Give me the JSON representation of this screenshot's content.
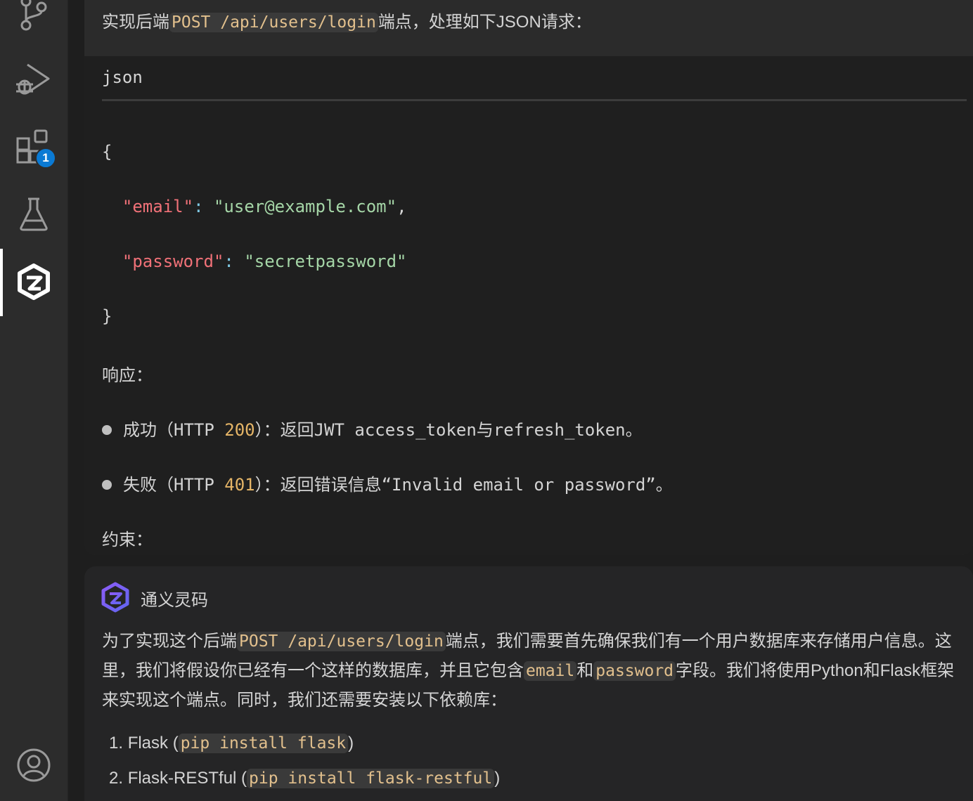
{
  "activity_bar": {
    "items": [
      {
        "name": "source-control",
        "icon": "source-control-icon"
      },
      {
        "name": "run-debug",
        "icon": "run-debug-icon"
      },
      {
        "name": "extensions",
        "icon": "extensions-icon",
        "badge": "1"
      },
      {
        "name": "testing",
        "icon": "flask-icon"
      },
      {
        "name": "tongyi-lingma",
        "icon": "tongyi-logo-icon",
        "active": true
      }
    ],
    "bottom": {
      "name": "accounts",
      "icon": "account-icon"
    },
    "accent": "#ffffff",
    "badge_color": "#0a7ad4"
  },
  "user_message": {
    "intro_before": "实现后端",
    "intro_code": "POST /api/users/login",
    "intro_after": "端点，处理如下JSON请求：",
    "code_block": {
      "language": "json",
      "open_brace": "{",
      "line1_key": "\"email\"",
      "line1_colon": ":",
      "line1_value": "\"user@example.com\"",
      "line1_comma": ",",
      "line2_key": "\"password\"",
      "line2_colon": ":",
      "line2_value": "\"secretpassword\"",
      "close_brace": "}"
    },
    "response_heading": "响应：",
    "bullets": [
      {
        "prefix": "成功（HTTP ",
        "code": "200",
        "suffix": "）：返回JWT access_token与refresh_token。"
      },
      {
        "prefix": "失败（HTTP ",
        "code": "401",
        "suffix": "）：返回错误信息“Invalid email or password”。"
      }
    ],
    "constraints_heading": "约束："
  },
  "assistant_message": {
    "name": "通义灵码",
    "para_1": "为了实现这个后端",
    "para_code_1": "POST /api/users/login",
    "para_2": "端点，我们需要首先确保我们有一个用户数据库来存储用户信息。这里，我们将假设你已经有一个这样的数据库，并且它包含",
    "para_code_2": "email",
    "para_3": "和",
    "para_code_3": "password",
    "para_4": "字段。我们将使用Python和Flask框架来实现这个端点。同时，我们还需要安装以下依赖库：",
    "list": [
      {
        "num": "1.",
        "name": "Flask",
        "open": " (",
        "code": "pip install flask",
        "close": ")"
      },
      {
        "num": "2.",
        "name": "Flask-RESTful",
        "open": " (",
        "code": "pip install flask-restful",
        "close": ")"
      }
    ]
  }
}
